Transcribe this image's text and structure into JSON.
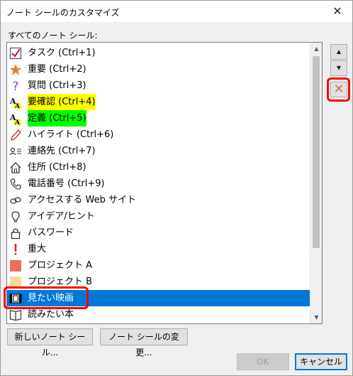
{
  "window": {
    "title": "ノート シールのカスタマイズ",
    "close_glyph": "✕"
  },
  "list": {
    "label": "すべてのノート シール:",
    "items": [
      {
        "label": "タスク (Ctrl+1)",
        "icon": "checkbox-icon"
      },
      {
        "label": "重要 (Ctrl+2)",
        "icon": "star-icon"
      },
      {
        "label": "質問 (Ctrl+3)",
        "icon": "question-icon"
      },
      {
        "label": "要確認 (Ctrl+4)",
        "icon": "highlight-a-icon",
        "highlight": "#ffff00"
      },
      {
        "label": "定義 (Ctrl+5)",
        "icon": "highlight-a-icon",
        "highlight": "#00ff00"
      },
      {
        "label": "ハイライト (Ctrl+6)",
        "icon": "pencil-icon"
      },
      {
        "label": "連絡先 (Ctrl+7)",
        "icon": "contact-icon"
      },
      {
        "label": "住所 (Ctrl+8)",
        "icon": "house-icon"
      },
      {
        "label": "電話番号 (Ctrl+9)",
        "icon": "phone-icon"
      },
      {
        "label": "アクセスする Web サイト",
        "icon": "link-icon"
      },
      {
        "label": "アイデア/ヒント",
        "icon": "lightbulb-icon"
      },
      {
        "label": "パスワード",
        "icon": "lock-icon"
      },
      {
        "label": "重大",
        "icon": "exclamation-icon"
      },
      {
        "label": "プロジェクト A",
        "icon": "square-red-icon"
      },
      {
        "label": "プロジェクト B",
        "icon": "square-yellow-icon"
      },
      {
        "label": "見たい映画",
        "icon": "film-icon",
        "selected": true
      },
      {
        "label": "読みたい本",
        "icon": "book-icon"
      }
    ]
  },
  "side_buttons": {
    "up": "▲",
    "down": "▼",
    "delete": "✕"
  },
  "buttons": {
    "new_tag": "新しいノート シール...",
    "modify_tag": "ノート シールの変更...",
    "ok": "OK",
    "cancel": "キャンセル"
  },
  "colors": {
    "selection": "#0078d7",
    "callout": "#ff0000",
    "project_a": "#e8705a",
    "project_b": "#f8d99a"
  }
}
